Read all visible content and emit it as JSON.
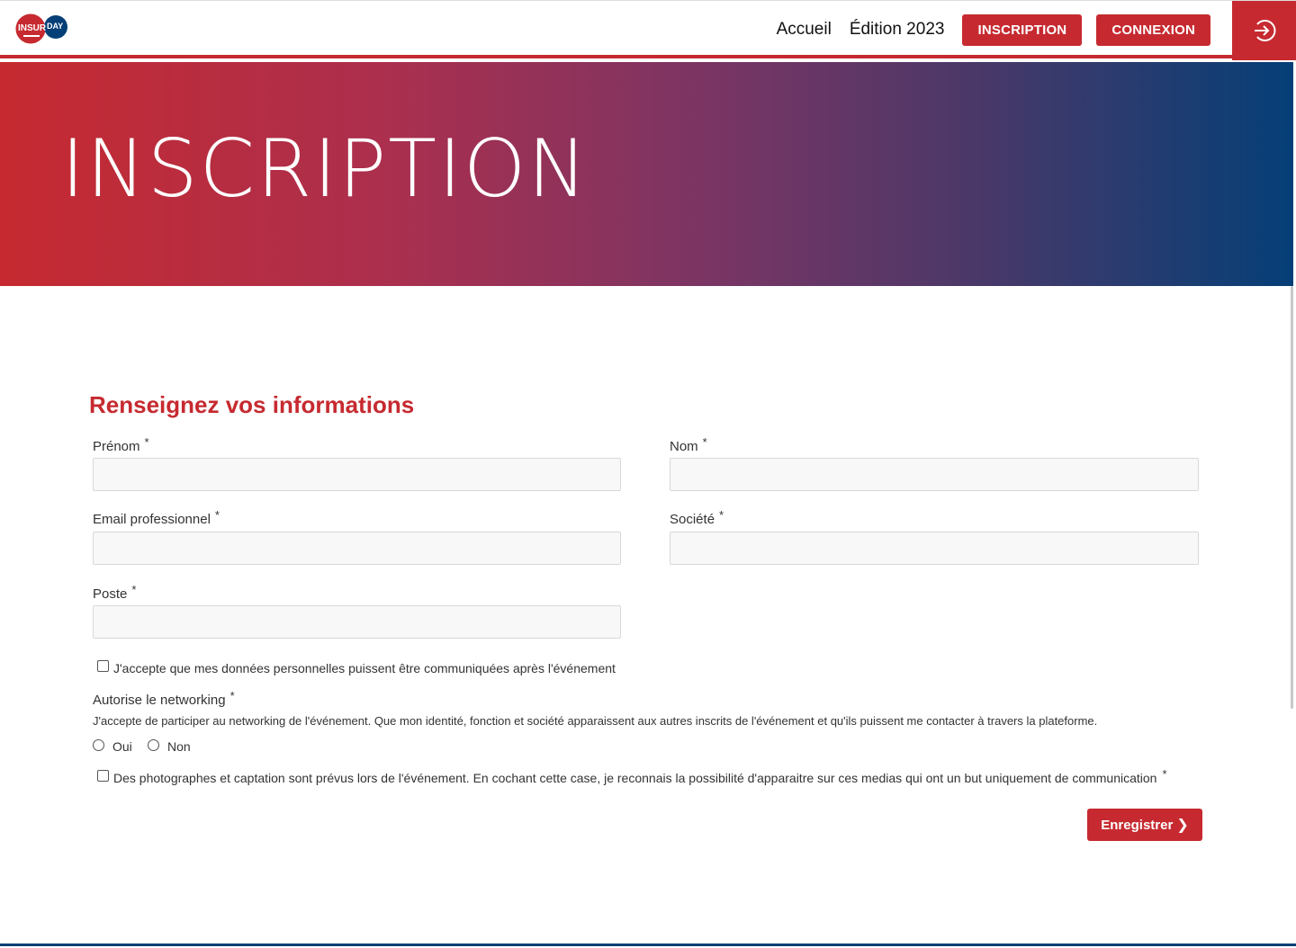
{
  "header": {
    "logo": {
      "word1": "INSUR",
      "word2": "DAY"
    },
    "nav": {
      "home": "Accueil",
      "edition": "Édition 2023"
    },
    "buttons": {
      "register": "INSCRIPTION",
      "login": "CONNEXION"
    },
    "login_icon": "login-arrow-icon"
  },
  "banner": {
    "title": "INSCRIPTION"
  },
  "form": {
    "title": "Renseignez vos informations",
    "required_mark": "*",
    "fields": {
      "first_name": {
        "label": "Prénom",
        "value": ""
      },
      "last_name": {
        "label": "Nom",
        "value": ""
      },
      "email": {
        "label": "Email professionnel",
        "value": ""
      },
      "company": {
        "label": "Société",
        "value": ""
      },
      "position": {
        "label": "Poste",
        "value": ""
      }
    },
    "consent_data": {
      "label": "J'accepte que mes données personnelles puissent être communiquées après l'événement",
      "checked": false
    },
    "networking": {
      "label": "Autorise le networking",
      "description": "J'accepte de participer au networking de l'événement. Que mon identité, fonction et société apparaissent aux autres inscrits de l'événement et qu'ils puissent me contacter à travers la plateforme.",
      "options": [
        "Oui",
        "Non"
      ],
      "selected": ""
    },
    "consent_photo": {
      "label": "Des photographes et captation sont prévus lors de l'événement. En cochant cette case, je reconnais la possibilité d'apparaitre sur ces medias qui ont un but uniquement de communication",
      "checked": false
    },
    "submit_label": "Enregistrer"
  },
  "colors": {
    "accent": "#c62a30",
    "navy": "#053f77"
  }
}
